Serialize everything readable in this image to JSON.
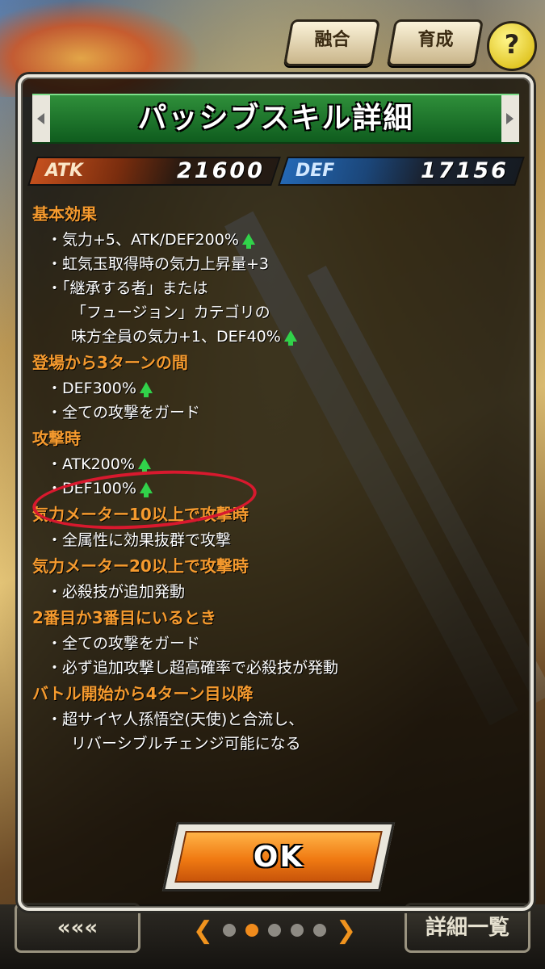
{
  "header": {
    "fusion_button": "融合",
    "training_button": "育成",
    "help_button": "?"
  },
  "modal": {
    "title": "パッシブスキル詳細",
    "atk_label": "ATK",
    "atk_value": "21600",
    "def_label": "DEF",
    "def_value": "17156",
    "sections": [
      {
        "heading": "基本効果",
        "lines": [
          {
            "text": "・気力+5、ATK/DEF200%",
            "arrow": true
          },
          {
            "text": "・虹気玉取得時の気力上昇量+3",
            "arrow": false
          },
          {
            "text": "・「継承する者」または",
            "arrow": false
          },
          {
            "text": "「フュージョン」カテゴリの",
            "arrow": false,
            "cont": true
          },
          {
            "text": "味方全員の気力+1、DEF40%",
            "arrow": true,
            "cont": true
          }
        ]
      },
      {
        "heading": "登場から3ターンの間",
        "lines": [
          {
            "text": "・DEF300%",
            "arrow": true
          },
          {
            "text": "・全ての攻撃をガード",
            "arrow": false
          }
        ]
      },
      {
        "heading": "攻撃時",
        "lines": [
          {
            "text": "・ATK200%",
            "arrow": true
          },
          {
            "text": "・DEF100%",
            "arrow": true
          }
        ]
      },
      {
        "heading": "気力メーター10以上で攻撃時",
        "lines": [
          {
            "text": "・全属性に効果抜群で攻撃",
            "arrow": false
          }
        ]
      },
      {
        "heading": "気力メーター20以上で攻撃時",
        "lines": [
          {
            "text": "・必殺技が追加発動",
            "arrow": false
          }
        ]
      },
      {
        "heading": "2番目か3番目にいるとき",
        "lines": [
          {
            "text": "・全ての攻撃をガード",
            "arrow": false
          },
          {
            "text": "・必ず追加攻撃し超高確率で必殺技が発動",
            "arrow": false
          }
        ]
      },
      {
        "heading": "バトル開始から4ターン目以降",
        "lines": [
          {
            "text": "・超サイヤ人孫悟空(天使)と合流し、",
            "arrow": false
          },
          {
            "text": "リバーシブルチェンジ可能になる",
            "arrow": false,
            "cont": true
          }
        ]
      }
    ],
    "ok_button": "OK"
  },
  "footer": {
    "back_button": "«««",
    "detail_list_button": "詳細一覧"
  },
  "colors": {
    "section_heading": "#f59a2e",
    "title_bar": "#1f7a2c",
    "ok_button": "#f07a12",
    "annotation": "#d8192e",
    "up_arrow": "#31d24a"
  }
}
